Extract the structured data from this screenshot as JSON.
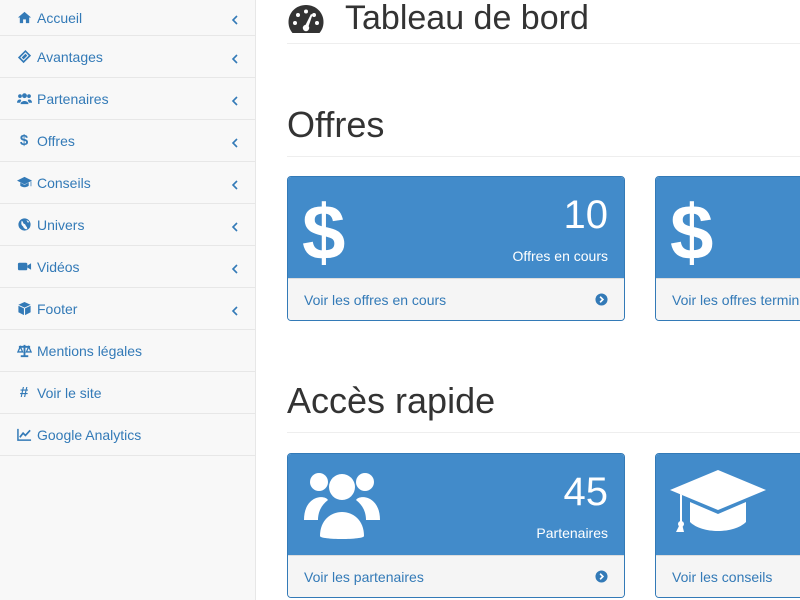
{
  "sidebar": {
    "items": [
      {
        "label": "Accueil",
        "icon": "home-icon"
      },
      {
        "label": "Avantages",
        "icon": "ticket-icon"
      },
      {
        "label": "Partenaires",
        "icon": "users-icon"
      },
      {
        "label": "Offres",
        "icon": "dollar-icon"
      },
      {
        "label": "Conseils",
        "icon": "graduation-cap-icon"
      },
      {
        "label": "Univers",
        "icon": "globe-icon"
      },
      {
        "label": "Vidéos",
        "icon": "video-camera-icon"
      },
      {
        "label": "Footer",
        "icon": "cube-icon"
      },
      {
        "label": "Mentions légales",
        "icon": "balance-scale-icon"
      },
      {
        "label": "Voir le site",
        "icon": "hashtag-icon"
      },
      {
        "label": "Google Analytics",
        "icon": "line-chart-icon"
      }
    ],
    "dollar_glyph": "$",
    "hash_glyph": "#"
  },
  "header": {
    "title": "Tableau de bord"
  },
  "sections": {
    "offres": {
      "title": "Offres",
      "panels": [
        {
          "count": "10",
          "label": "Offres en cours",
          "link": "Voir les offres en cours",
          "big_glyph": "$"
        },
        {
          "count": "",
          "label": "",
          "link": "Voir les offres terminées",
          "big_glyph": "$"
        }
      ]
    },
    "acces_rapide": {
      "title": "Accès rapide",
      "panels": [
        {
          "count": "45",
          "label": "Partenaires",
          "link": "Voir les partenaires"
        },
        {
          "count": "",
          "label": "",
          "link": "Voir les conseils"
        }
      ]
    }
  },
  "colors": {
    "primary": "#428bca",
    "link": "#337ab7",
    "sidebar_bg": "#f8f8f8"
  }
}
